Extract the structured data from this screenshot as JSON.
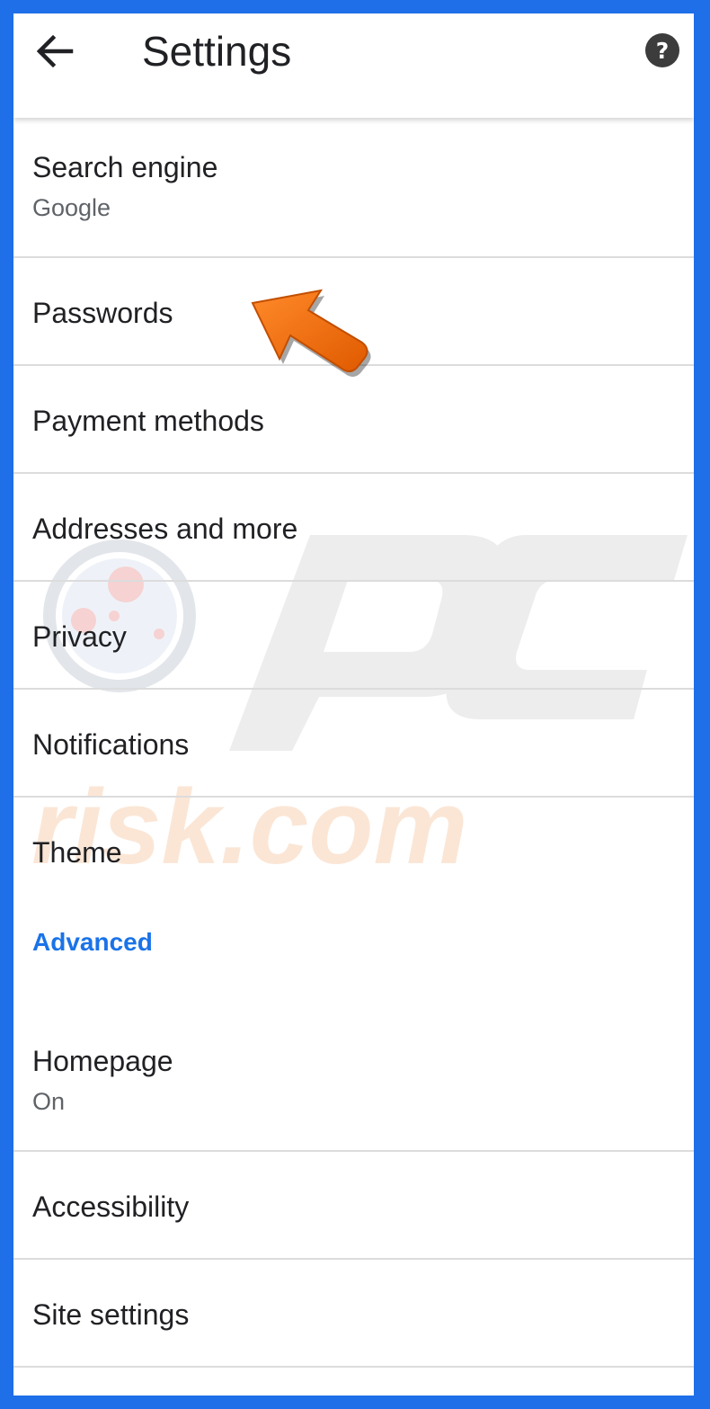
{
  "header": {
    "title": "Settings",
    "back_icon": "arrow-back-icon",
    "help_icon": "help-icon",
    "help_glyph": "?"
  },
  "settings": {
    "search_engine": {
      "label": "Search engine",
      "value": "Google"
    },
    "passwords": {
      "label": "Passwords"
    },
    "payment_methods": {
      "label": "Payment methods"
    },
    "addresses": {
      "label": "Addresses and more"
    },
    "privacy": {
      "label": "Privacy"
    },
    "notifications": {
      "label": "Notifications"
    },
    "theme": {
      "label": "Theme"
    },
    "advanced_header": "Advanced",
    "homepage": {
      "label": "Homepage",
      "value": "On"
    },
    "accessibility": {
      "label": "Accessibility"
    },
    "site_settings": {
      "label": "Site settings"
    }
  },
  "colors": {
    "frame_border": "#1e6fe8",
    "accent": "#1a73e8",
    "annotation_arrow": "#f36c0a"
  }
}
